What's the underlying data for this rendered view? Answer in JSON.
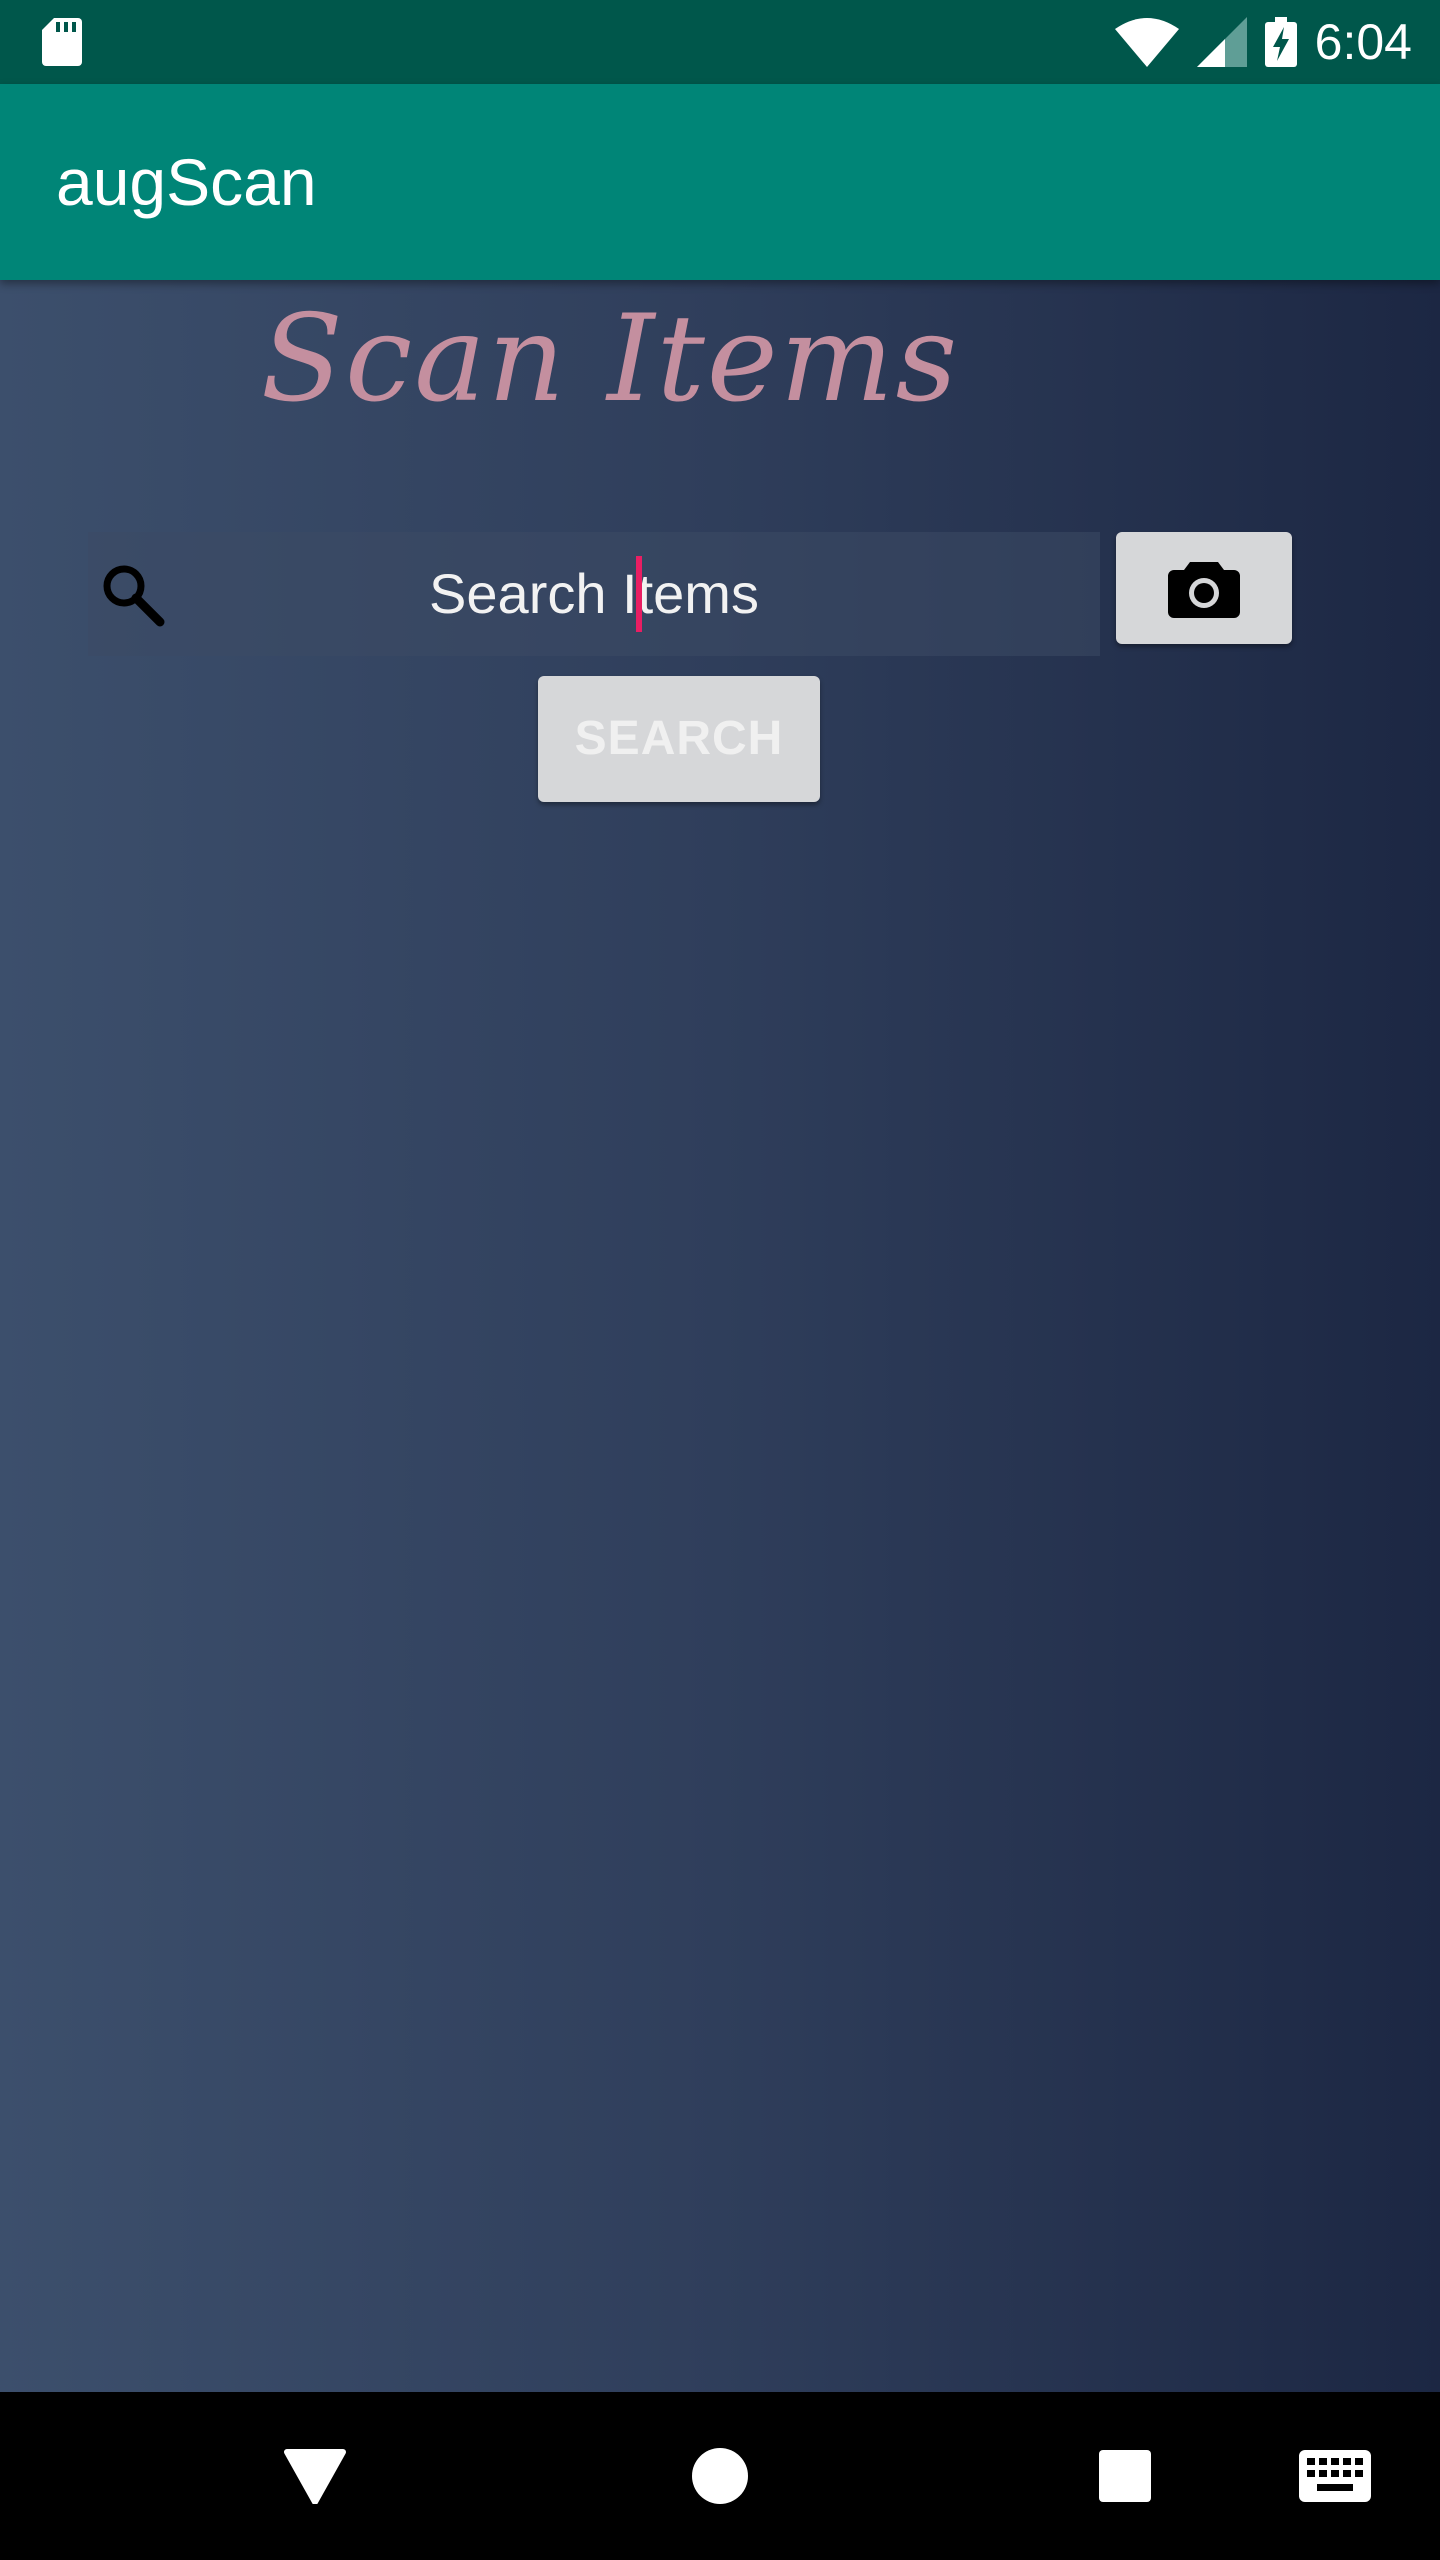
{
  "status_bar": {
    "time": "6:04",
    "icons": [
      "sd-card-icon",
      "wifi-icon",
      "signal-icon",
      "battery-charging-icon"
    ]
  },
  "app_bar": {
    "title": "augScan"
  },
  "main": {
    "heading": "Scan Items",
    "search": {
      "value": "Search Items"
    },
    "camera_button": {
      "icon": "camera-icon"
    },
    "search_button_label": "SEARCH"
  },
  "colors": {
    "status_bar": "#00574b",
    "app_bar": "#008577",
    "heading": "#c48f9f",
    "cursor": "#e91e63",
    "button": "#d6d7d9"
  },
  "nav_bar": {
    "icons": [
      "back-icon",
      "home-icon",
      "recents-icon",
      "keyboard-icon"
    ]
  }
}
